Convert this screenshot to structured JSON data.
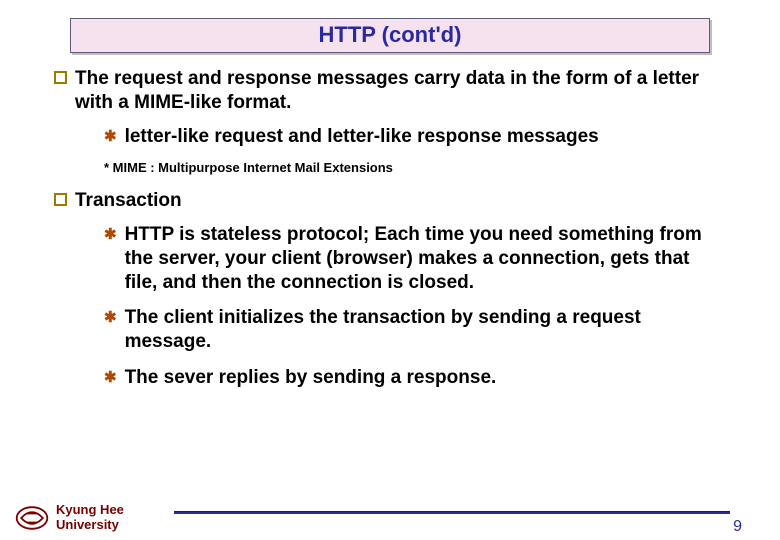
{
  "title": "HTTP (cont'd)",
  "items": [
    {
      "text": "The request and response messages carry data in the form of a letter with a MIME-like format.",
      "subs": [
        {
          "text": "letter-like request and letter-like response messages"
        }
      ],
      "footnote": "* MIME : Multipurpose Internet Mail Extensions"
    },
    {
      "text": "Transaction",
      "subs": [
        {
          "text": "HTTP is stateless protocol; Each time you need something from the server, your client (browser) makes a connection, gets that file, and then the connection is closed."
        },
        {
          "text": "The client initializes the transaction by sending a request message."
        },
        {
          "text": "The sever replies by sending a response."
        }
      ]
    }
  ],
  "footer": {
    "brand_line1": "Kyung Hee",
    "brand_line2": "University",
    "page": "9"
  }
}
